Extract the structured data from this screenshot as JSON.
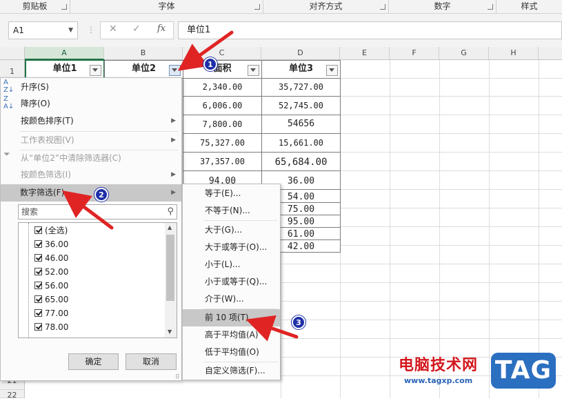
{
  "ribbon": {
    "groups": [
      "剪贴板",
      "字体",
      "对齐方式",
      "数字",
      "样式"
    ]
  },
  "formula_bar": {
    "name_box": "A1",
    "formula": "单位1",
    "fx_label": "fx"
  },
  "columns": [
    "A",
    "B",
    "C",
    "D",
    "E",
    "F",
    "G",
    "H"
  ],
  "rows": [
    "1",
    "21",
    "22"
  ],
  "table": {
    "headers": [
      "单位1",
      "单位2",
      "面积",
      "单位3"
    ],
    "col_c": [
      "2,340.00",
      "6,006.00",
      "7,800.00",
      "75,327.00",
      "37,357.00",
      "94.00"
    ],
    "col_d": [
      "35,727.00",
      "52,745.00",
      "54656",
      "15,661.00",
      "65,684.00",
      "36.00",
      "54.00",
      "75.00",
      "95.00",
      "61.00",
      "42.00"
    ]
  },
  "menu": {
    "items": [
      "升序(S)",
      "降序(O)",
      "按颜色排序(T)",
      "工作表视图(V)",
      "从“单位2”中清除筛选器(C)",
      "按颜色筛选(I)",
      "数字筛选(F)"
    ],
    "search_placeholder": "搜索",
    "list": [
      "(全选)",
      "36.00",
      "46.00",
      "52.00",
      "56.00",
      "65.00",
      "77.00",
      "78.00"
    ],
    "ok": "确定",
    "cancel": "取消"
  },
  "submenu": {
    "items": [
      "等于(E)...",
      "不等于(N)...",
      "大于(G)...",
      "大于或等于(O)...",
      "小于(L)...",
      "小于或等于(Q)...",
      "介于(W)...",
      "前 10 项(T)...",
      "高于平均值(A)",
      "低于平均值(O)",
      "自定义筛选(F)..."
    ]
  },
  "annotations": {
    "badges": [
      "1",
      "2",
      "3"
    ],
    "arrow_color": "#e02424"
  },
  "watermark": {
    "site_name": "电脑技术网",
    "url": "www.tagxp.com",
    "tag": "TAG"
  }
}
